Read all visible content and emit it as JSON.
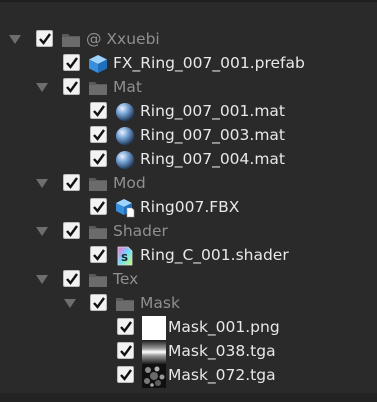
{
  "tree": {
    "root": {
      "label": "@ Xxuebi"
    },
    "prefab": {
      "label": "FX_Ring_007_001.prefab"
    },
    "folder_mat": {
      "label": "Mat"
    },
    "mat_1": {
      "label": "Ring_007_001.mat"
    },
    "mat_2": {
      "label": "Ring_007_003.mat"
    },
    "mat_3": {
      "label": "Ring_007_004.mat"
    },
    "folder_mod": {
      "label": "Mod"
    },
    "fbx": {
      "label": "Ring007.FBX"
    },
    "folder_shader": {
      "label": "Shader"
    },
    "shader": {
      "label": "Ring_C_001.shader"
    },
    "folder_tex": {
      "label": "Tex"
    },
    "folder_mask": {
      "label": "Mask"
    },
    "tex_1": {
      "label": "Mask_001.png"
    },
    "tex_2": {
      "label": "Mask_038.tga"
    },
    "tex_3": {
      "label": "Mask_072.tga"
    }
  },
  "icons": {
    "folder": "folder-icon",
    "prefab": "prefab-cube-icon",
    "material": "material-sphere-icon",
    "model": "model-icon",
    "shader": "shader-icon",
    "texture": "texture-thumbnail-icon"
  },
  "colors": {
    "background": "#2a2a2a",
    "text": "#e8e8e8",
    "text_dim": "#8f8f8f",
    "checkbox": "#f2f2f2"
  }
}
